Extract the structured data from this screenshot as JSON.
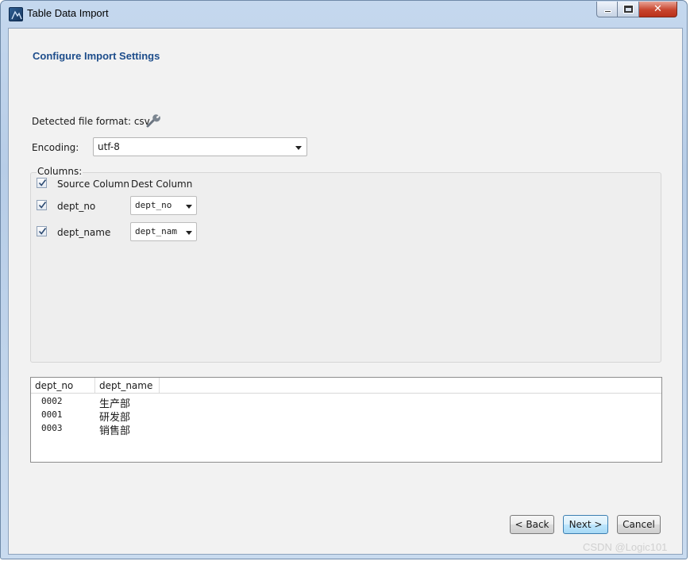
{
  "window": {
    "title": "Table Data Import"
  },
  "page": {
    "title": "Configure Import Settings"
  },
  "format": {
    "label": "Detected file format: csv"
  },
  "encoding": {
    "label": "Encoding:",
    "value": "utf-8"
  },
  "columns": {
    "group_label": "Columns:",
    "header_source": "Source Column",
    "header_dest": "Dest Column",
    "header_checked": true,
    "rows": [
      {
        "source": "dept_no",
        "dest": "dept_no",
        "checked": true
      },
      {
        "source": "dept_name",
        "dest": "dept_nam",
        "checked": true
      }
    ]
  },
  "preview": {
    "headers": [
      "dept_no",
      "dept_name"
    ],
    "rows": [
      [
        "0002",
        "生产部"
      ],
      [
        "0001",
        "研发部"
      ],
      [
        "0003",
        "销售部"
      ]
    ]
  },
  "buttons": {
    "back": "< Back",
    "next": "Next >",
    "cancel": "Cancel"
  },
  "watermark": "CSDN @Logic101",
  "icons": {
    "app": "mysql-workbench-icon",
    "format_settings": "wrench-icon"
  },
  "colors": {
    "title_accent": "#1d4d8b",
    "close_button": "#c8452e"
  }
}
